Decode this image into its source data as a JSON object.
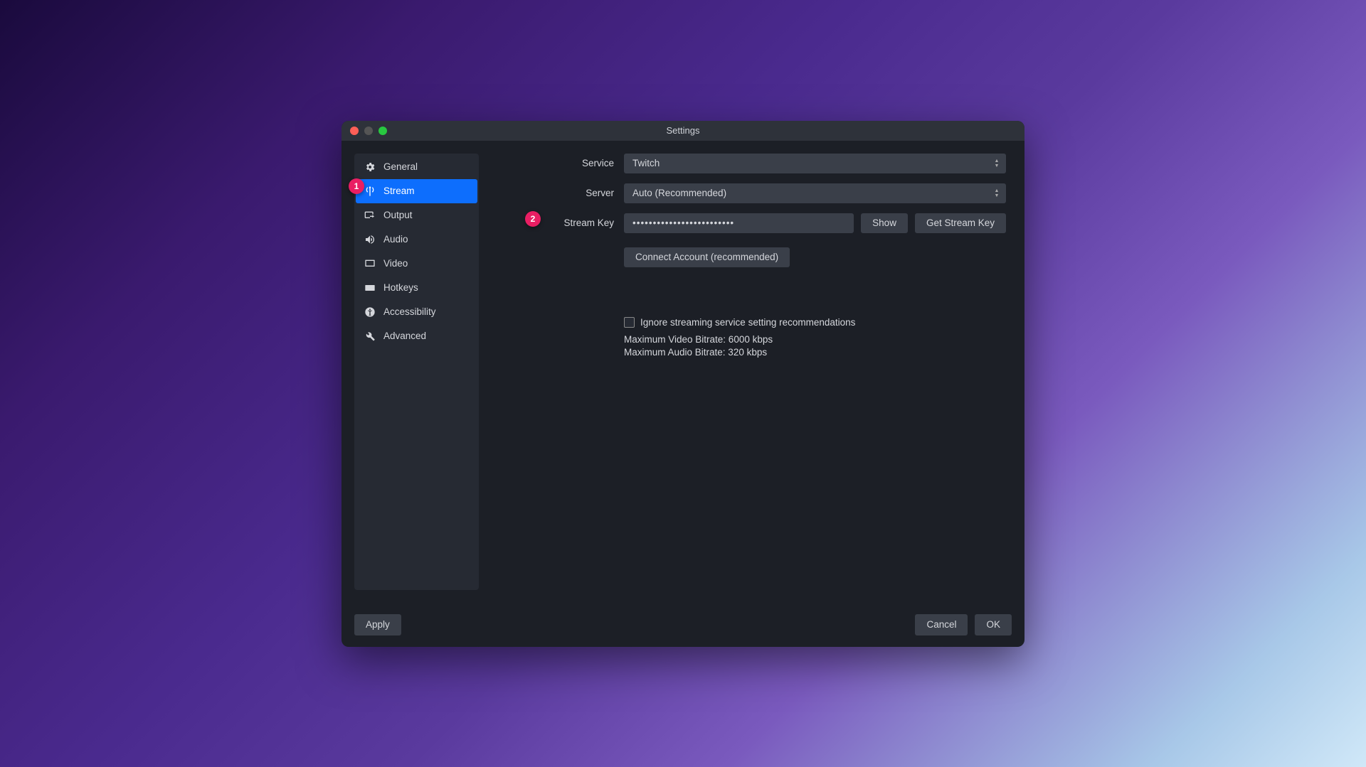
{
  "window": {
    "title": "Settings"
  },
  "sidebar": {
    "items": [
      {
        "label": "General"
      },
      {
        "label": "Stream"
      },
      {
        "label": "Output"
      },
      {
        "label": "Audio"
      },
      {
        "label": "Video"
      },
      {
        "label": "Hotkeys"
      },
      {
        "label": "Accessibility"
      },
      {
        "label": "Advanced"
      }
    ]
  },
  "form": {
    "service_label": "Service",
    "service_value": "Twitch",
    "server_label": "Server",
    "server_value": "Auto (Recommended)",
    "streamkey_label": "Stream Key",
    "streamkey_value": "•••••••••••••••••••••••••",
    "show_label": "Show",
    "get_key_label": "Get Stream Key",
    "connect_label": "Connect Account (recommended)",
    "ignore_label": "Ignore streaming service setting recommendations",
    "max_video": "Maximum Video Bitrate: 6000 kbps",
    "max_audio": "Maximum Audio Bitrate: 320 kbps"
  },
  "footer": {
    "apply": "Apply",
    "cancel": "Cancel",
    "ok": "OK"
  },
  "annotations": {
    "badge1": "1",
    "badge2": "2"
  }
}
